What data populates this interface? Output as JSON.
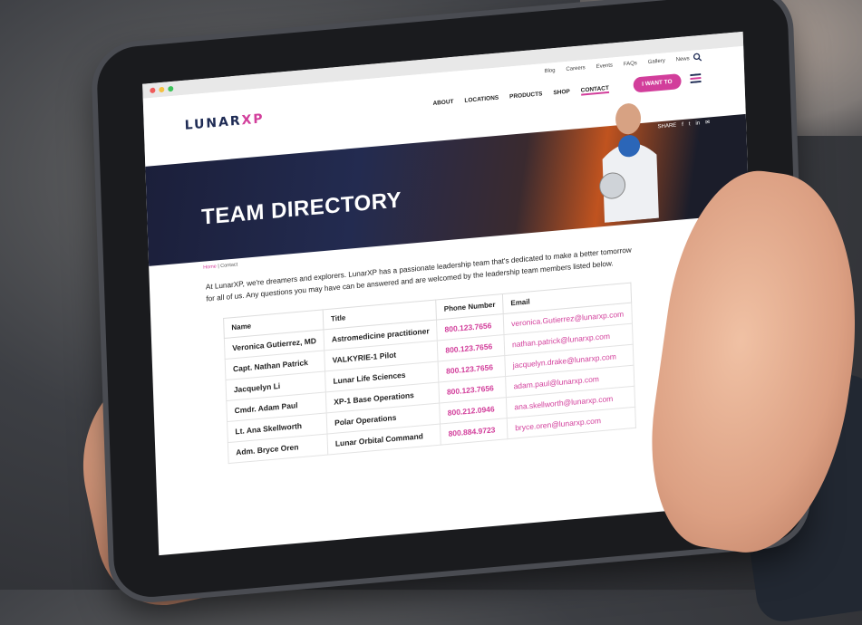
{
  "util_nav": [
    "Blog",
    "Careers",
    "Events",
    "FAQs",
    "Gallery",
    "News"
  ],
  "logo": {
    "word": "LUNAR",
    "mark": "XP"
  },
  "main_nav": [
    "ABOUT",
    "LOCATIONS",
    "PRODUCTS",
    "SHOP",
    "CONTACT"
  ],
  "cta_label": "I WANT TO",
  "hero_title": "TEAM DIRECTORY",
  "share_label": "SHARE",
  "breadcrumb": {
    "home": "Home",
    "current": "| Contact"
  },
  "intro": "At LunarXP, we're dreamers and explorers. LunarXP has a passionate leadership team that's dedicated to make a better tomorrow for all of us. Any questions you may have can be answered and are welcomed by the leadership team members listed below.",
  "table": {
    "headers": [
      "Name",
      "Title",
      "Phone Number",
      "Email"
    ],
    "rows": [
      {
        "name": "Veronica Gutierrez, MD",
        "title": "Astromedicine practitioner",
        "phone": "800.123.7656",
        "email": "veronica.Gutierrez@lunarxp.com"
      },
      {
        "name": "Capt. Nathan Patrick",
        "title": "VALKYRIE-1 Pilot",
        "phone": "800.123.7656",
        "email": "nathan.patrick@lunarxp.com"
      },
      {
        "name": "Jacquelyn Li",
        "title": "Lunar Life Sciences",
        "phone": "800.123.7656",
        "email": "jacquelyn.drake@lunarxp.com"
      },
      {
        "name": "Cmdr. Adam Paul",
        "title": "XP-1 Base Operations",
        "phone": "800.123.7656",
        "email": "adam.paul@lunarxp.com"
      },
      {
        "name": "Lt. Ana Skellworth",
        "title": "Polar Operations",
        "phone": "800.212.0946",
        "email": "ana.skellworth@lunarxp.com"
      },
      {
        "name": "Adm. Bryce Oren",
        "title": "Lunar Orbital Command",
        "phone": "800.884.9723",
        "email": "bryce.oren@lunarxp.com"
      }
    ]
  },
  "colors": {
    "accent": "#d23e9b",
    "navy": "#1e2b54"
  }
}
